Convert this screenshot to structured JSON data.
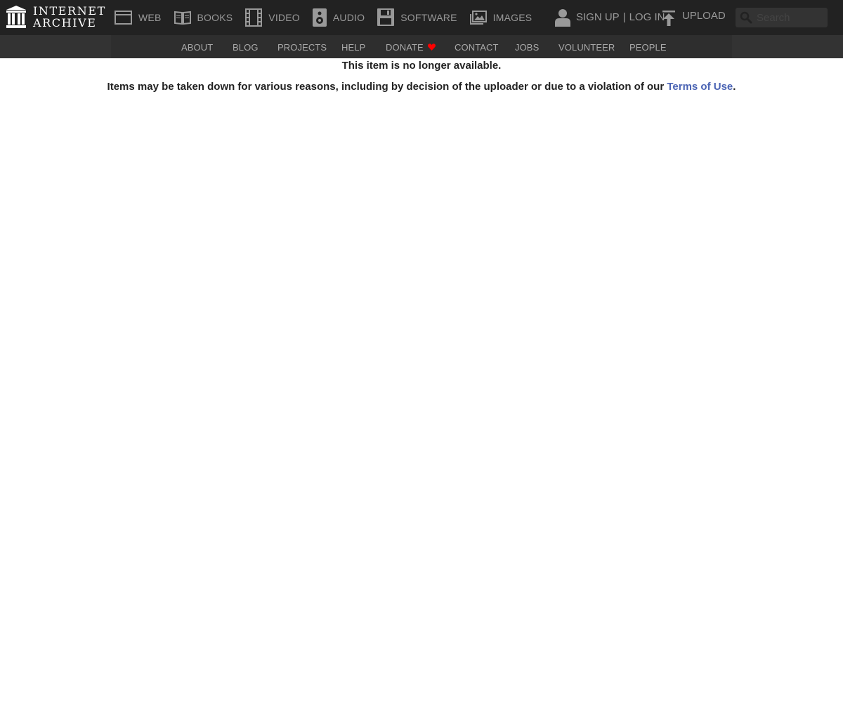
{
  "logo": {
    "line1": "INTERNET",
    "line2": "ARCHIVE"
  },
  "media_nav": [
    {
      "label": "WEB",
      "icon": "web-icon"
    },
    {
      "label": "BOOKS",
      "icon": "books-icon"
    },
    {
      "label": "VIDEO",
      "icon": "film-icon"
    },
    {
      "label": "AUDIO",
      "icon": "speaker-icon"
    },
    {
      "label": "SOFTWARE",
      "icon": "floppy-disk-icon"
    },
    {
      "label": "IMAGES",
      "icon": "images-icon"
    }
  ],
  "user": {
    "icon": "user-icon",
    "sign_up": "SIGN UP",
    "separator": "|",
    "log_in": "LOG IN"
  },
  "upload": {
    "label": "UPLOAD",
    "icon": "upload-icon"
  },
  "search": {
    "placeholder": "Search",
    "icon": "search-icon"
  },
  "subnav": [
    {
      "label": "ABOUT"
    },
    {
      "label": "BLOG"
    },
    {
      "label": "PROJECTS"
    },
    {
      "label": "HELP"
    },
    {
      "label": "DONATE",
      "icon": "heart-icon"
    },
    {
      "label": "CONTACT"
    },
    {
      "label": "JOBS"
    },
    {
      "label": "VOLUNTEER"
    },
    {
      "label": "PEOPLE"
    }
  ],
  "content": {
    "title": "This item is no longer available.",
    "message_prefix": "Items may be taken down for various reasons, including by decision of the uploader or due to a violation of our ",
    "terms_link": "Terms of Use",
    "message_suffix": "."
  },
  "colors": {
    "topbar_bg": "#222222",
    "subnav_bg": "#333333",
    "nav_text": "#999999",
    "link": "#4b64b4",
    "heart": "#ff0000",
    "body_text": "#222222"
  }
}
